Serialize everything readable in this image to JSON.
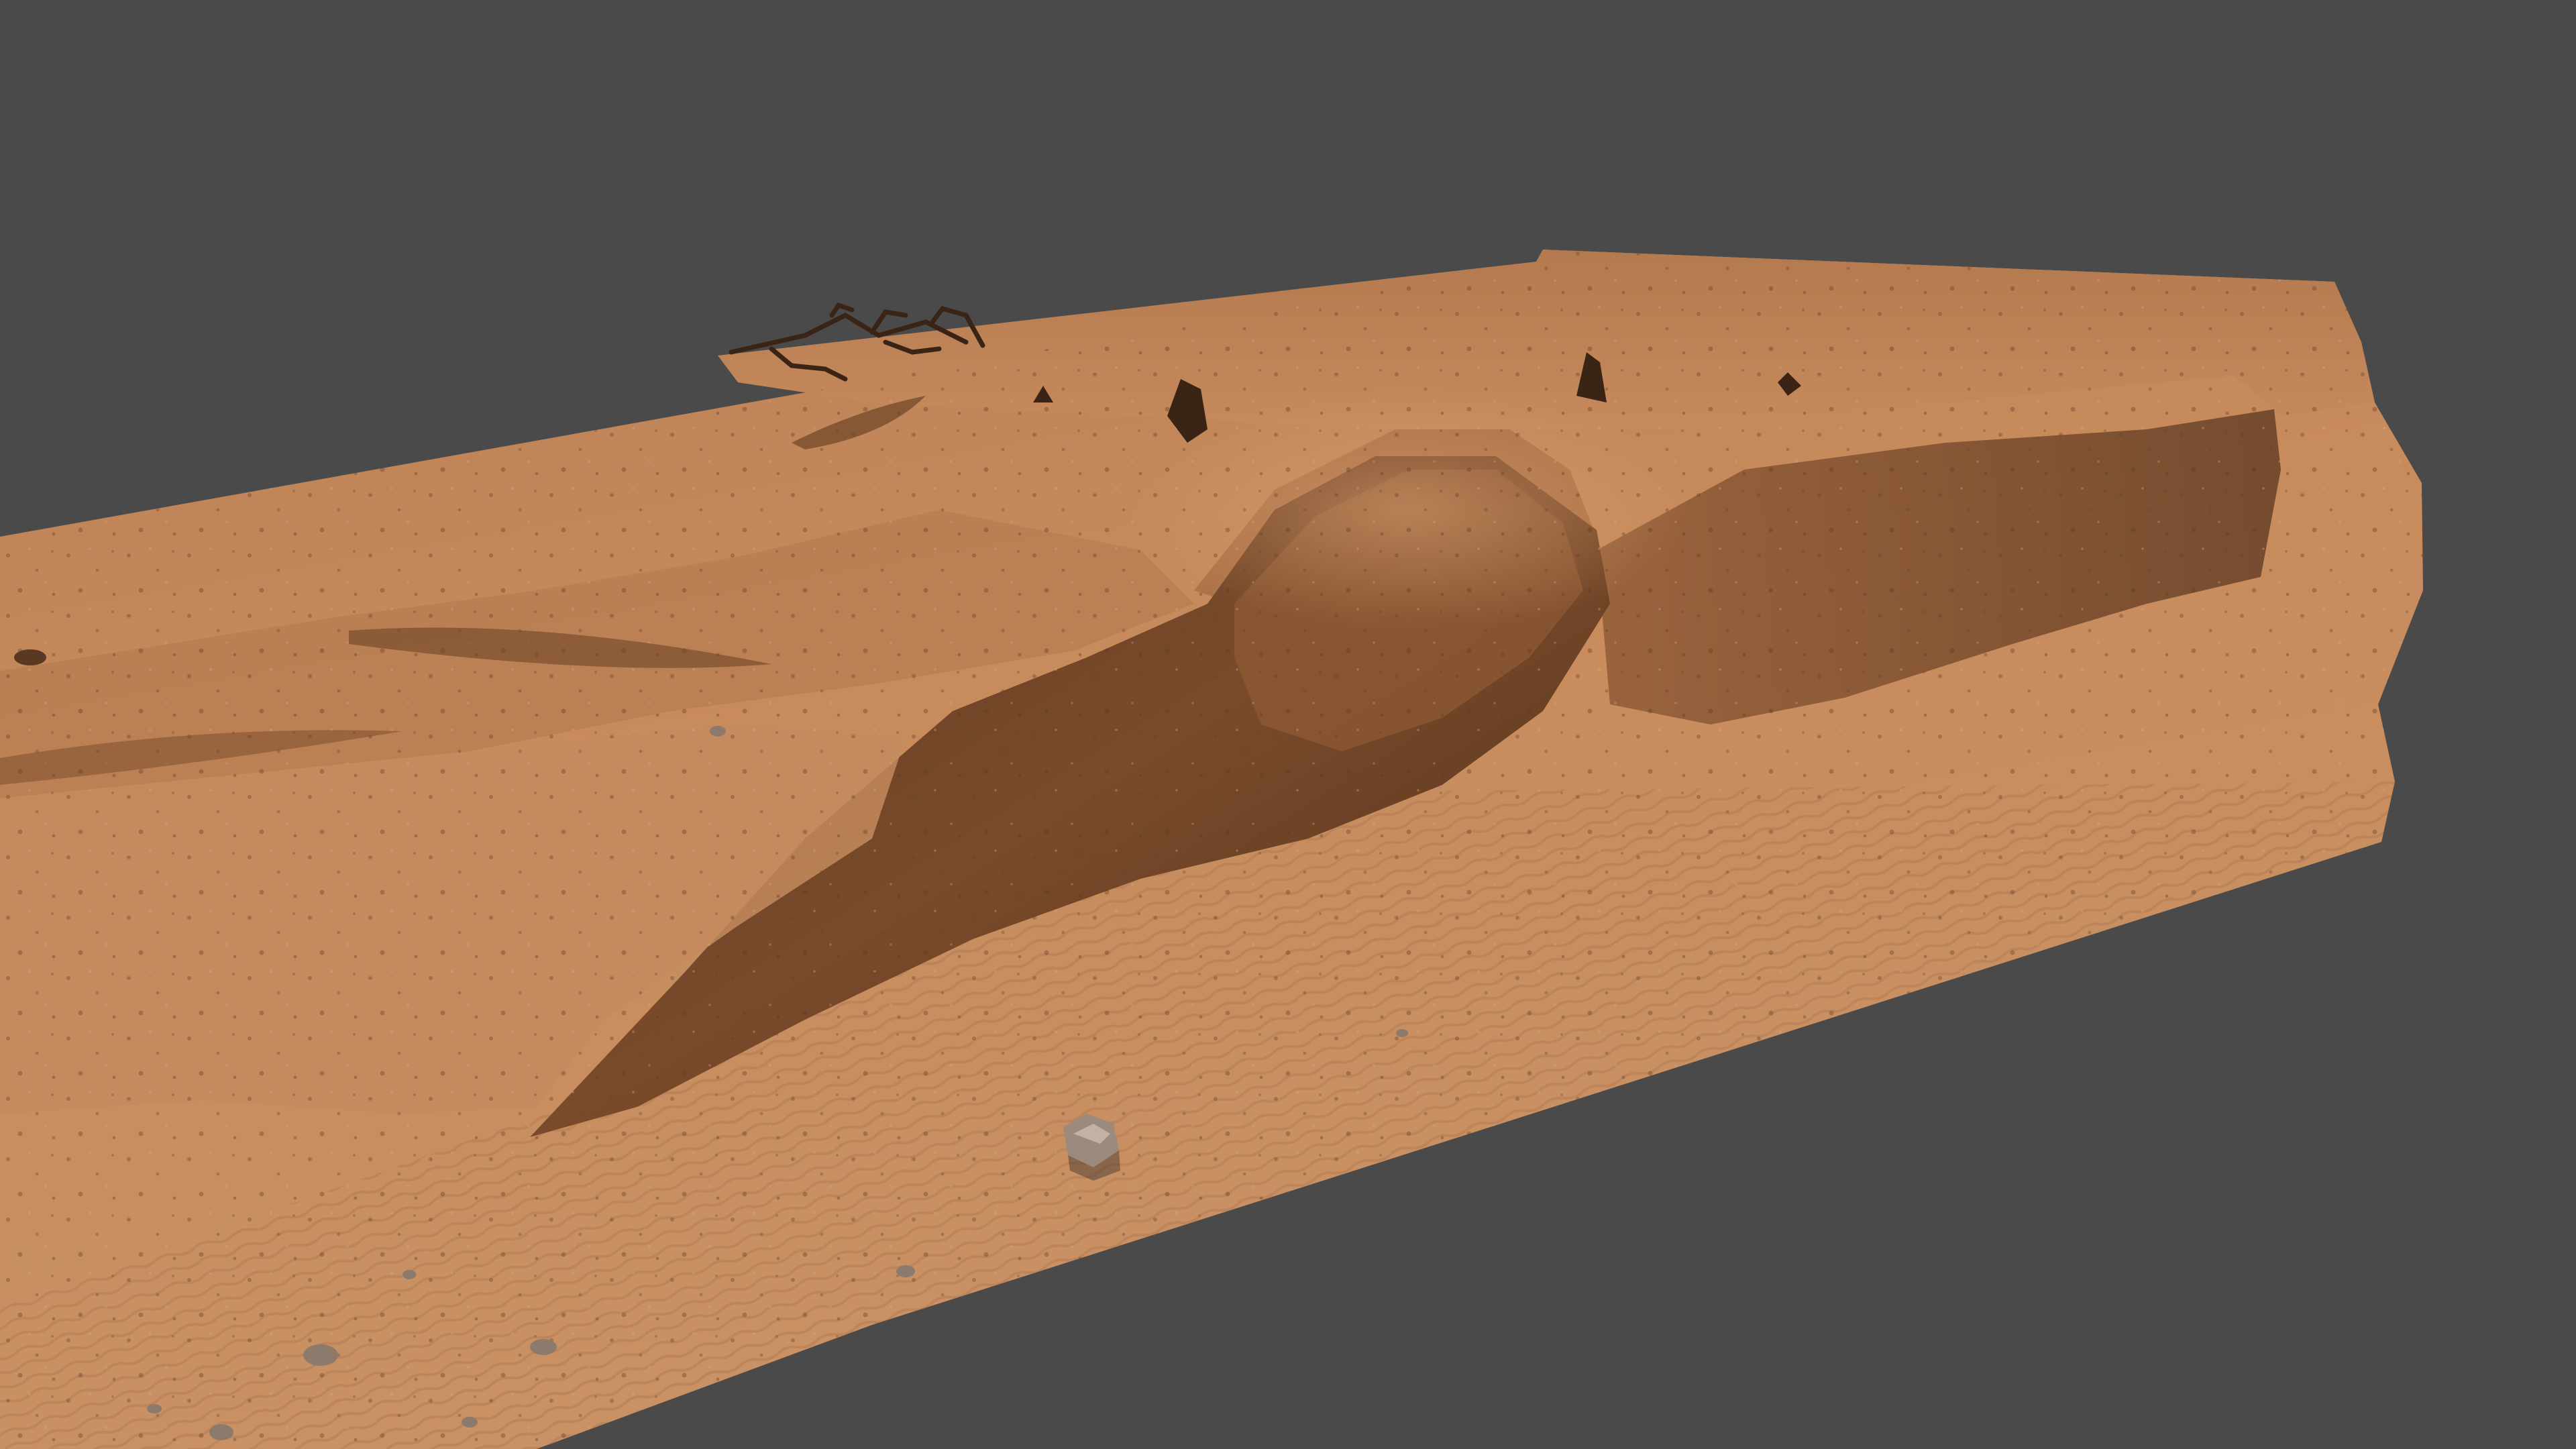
{
  "viewport": {
    "background_color": "#4a4a4b",
    "model": {
      "subject": "terrain-mesh",
      "sand_base_color": "#c4875a",
      "sand_light_color": "#d49a6b",
      "sand_shadow_color": "#6e4426",
      "sand_deep_shadow_color": "#4a2b16",
      "dry_brush_color": "#3a2415",
      "pebble_color": "#9c8a7c"
    }
  }
}
